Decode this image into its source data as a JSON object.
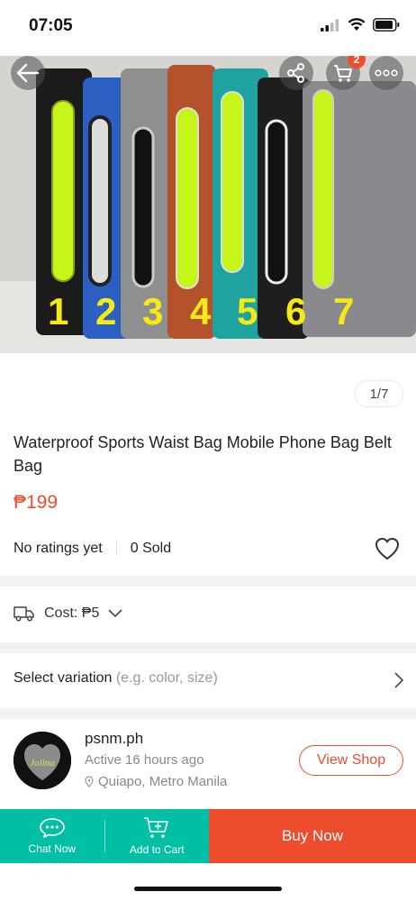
{
  "status_bar": {
    "time": "07:05"
  },
  "hero": {
    "numbers": [
      "1",
      "2",
      "3",
      "4",
      "5",
      "6",
      "7"
    ],
    "cart_badge": "2",
    "counter": "1/7"
  },
  "product": {
    "title": "Waterproof Sports Waist Bag Mobile Phone Bag Belt Bag",
    "price": "₱199",
    "ratings": "No ratings yet",
    "sold": "0 Sold"
  },
  "shipping": {
    "cost": "Cost: ₱5"
  },
  "variation": {
    "label": "Select variation",
    "hint": "(e.g. color, size)"
  },
  "shop": {
    "name": "psnm.ph",
    "active": "Active 16 hours ago",
    "location": "Quiapo, Metro Manila",
    "view_label": "View Shop",
    "logo_text": "Jolina"
  },
  "bottom_bar": {
    "chat_label": "Chat Now",
    "cart_label": "Add to Cart",
    "buy_label": "Buy Now"
  },
  "colors": {
    "accent": "#ee4d2d",
    "teal": "#00bfa5",
    "lime": "#c6f51a"
  },
  "icons": [
    "signal-icon",
    "wifi-icon",
    "battery-icon",
    "back-arrow-icon",
    "share-icon",
    "cart-icon",
    "more-icon",
    "heart-icon",
    "truck-icon",
    "chevron-down-icon",
    "chevron-right-icon",
    "location-pin-icon",
    "chat-icon",
    "add-cart-icon"
  ]
}
